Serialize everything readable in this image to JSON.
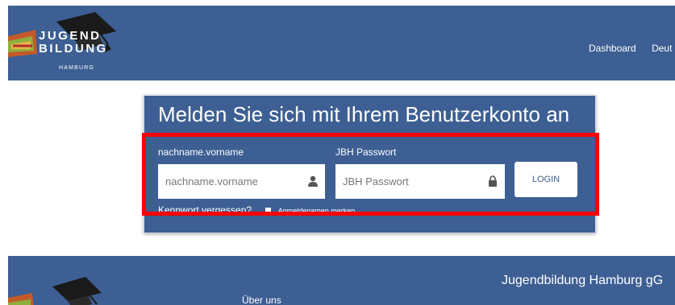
{
  "header": {
    "logo": {
      "line1": "JUGEND",
      "line2": "BILDUNG",
      "line3": "HAMBURG"
    },
    "nav": [
      "Dashboard",
      "Deut"
    ]
  },
  "login": {
    "title": "Melden Sie sich mit Ihrem Benutzerkonto an",
    "username_label": "nachname.vorname",
    "username_placeholder": "nachname.vorname",
    "password_label": "JBH Passwort",
    "password_placeholder": "JBH Passwort",
    "login_button": "LOGIN",
    "forgot_link": "Kennwort vergessen?",
    "remember_label": "Anmeldenamen merken"
  },
  "footer": {
    "about": "Über uns",
    "company": "Jugendbildung Hamburg gG"
  },
  "colors": {
    "brand_blue": "#3d5f93",
    "highlight_red": "#ff0000"
  }
}
